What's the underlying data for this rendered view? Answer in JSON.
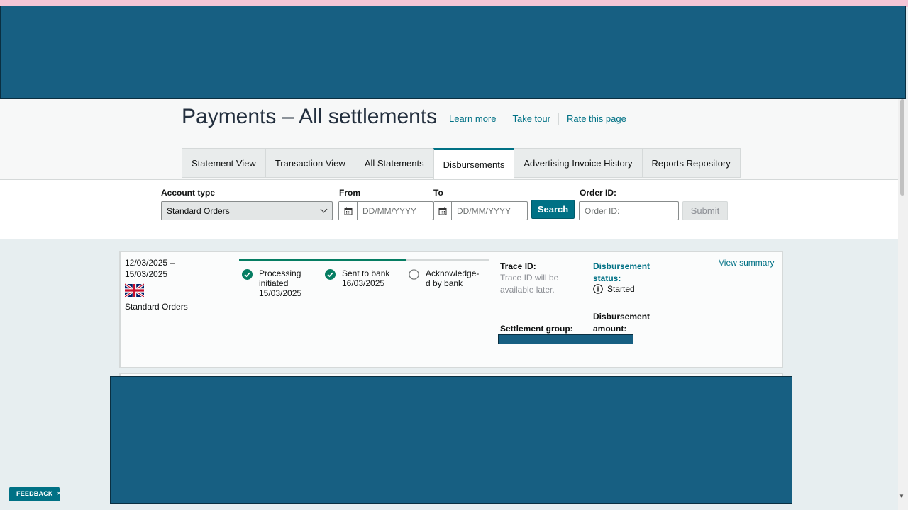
{
  "page": {
    "title": "Payments – All settlements",
    "links": [
      "Learn more",
      "Take tour",
      "Rate this page"
    ]
  },
  "tabs": [
    {
      "label": "Statement View",
      "active": false
    },
    {
      "label": "Transaction View",
      "active": false
    },
    {
      "label": "All Statements",
      "active": false
    },
    {
      "label": "Disbursements",
      "active": true
    },
    {
      "label": "Advertising Invoice History",
      "active": false
    },
    {
      "label": "Reports Repository",
      "active": false
    }
  ],
  "filters": {
    "account_type_label": "Account type",
    "account_type_value": "Standard Orders",
    "from_label": "From",
    "from_placeholder": "DD/MM/YYYY",
    "to_label": "To",
    "to_placeholder": "DD/MM/YYYY",
    "search_label": "Search",
    "order_id_label": "Order ID:",
    "order_id_placeholder": "Order ID:",
    "submit_label": "Submit"
  },
  "disbursement": {
    "date_range_line1": "12/03/2025 –",
    "date_range_line2": "15/03/2025",
    "marketplace_flag": "uk-flag-icon",
    "account": "Standard Orders",
    "progress_fraction": 0.67,
    "steps": [
      {
        "line1": "Processing",
        "line2": "initiated",
        "line3": "15/03/2025",
        "done": true
      },
      {
        "line1": "Sent to bank",
        "line2": "16/03/2025",
        "done": true
      },
      {
        "line1": "Acknowledge-",
        "line2": "d by bank",
        "done": false
      }
    ],
    "trace_label": "Trace ID:",
    "trace_value": "Trace ID will be available later.",
    "settlement_group_label": "Settlement group:",
    "status_label": "Disbursement status:",
    "status_value": "Started",
    "amount_label": "Disbursement amount:",
    "view_summary": "View summary"
  },
  "feedback": {
    "label": "FEEDBACK",
    "close": "×"
  },
  "colors": {
    "accent": "#007185",
    "success": "#067d62",
    "redaction": "#175f82"
  }
}
